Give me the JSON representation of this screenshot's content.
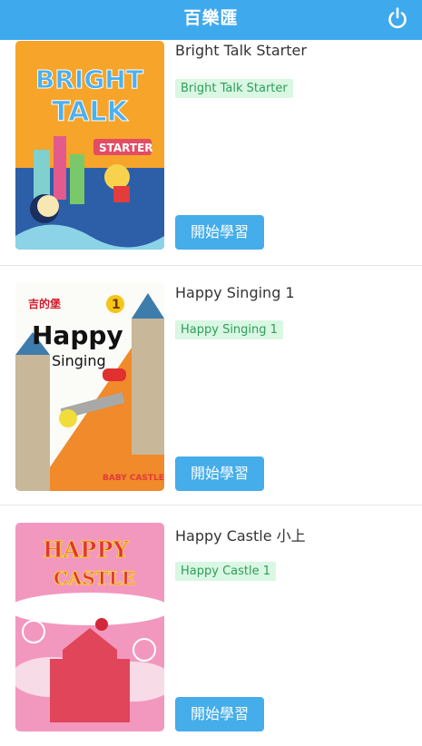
{
  "header": {
    "title": "百樂匯",
    "power_icon": "power-icon"
  },
  "courses": [
    {
      "title": "Bright Talk Starter",
      "tag": "Bright Talk Starter",
      "button": "開始學習",
      "cover_text": [
        "BRIGHT",
        "TALK",
        "STARTER"
      ]
    },
    {
      "title": "Happy Singing 1",
      "tag": "Happy Singing 1",
      "button": "開始學習",
      "cover_text": [
        "吉的堡",
        "1",
        "Happy",
        "Singing",
        "BABY CASTLE"
      ]
    },
    {
      "title": "Happy Castle 小上",
      "tag": "Happy Castle 1",
      "button": "開始學習",
      "cover_text": [
        "HAPPY",
        "CASTLE"
      ]
    }
  ],
  "colors": {
    "header": "#3fa9ee",
    "button": "#45ade9",
    "tag_bg": "#d9f7e3",
    "tag_text": "#2f9d5a"
  }
}
